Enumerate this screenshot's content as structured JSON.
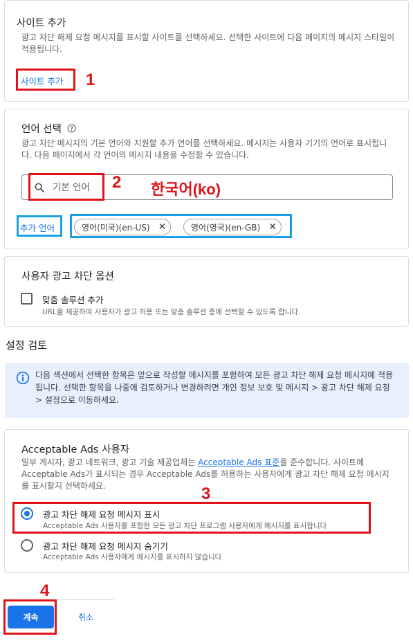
{
  "site_card": {
    "title": "사이트 추가",
    "desc": "광고 차단 해제 요청 메시지를 표시할 사이트를 선택하세요. 선택한 사이트에 다음 페이지의 메시지 스타일이 적용됩니다.",
    "add_site_link": "사이트 추가"
  },
  "language_card": {
    "title": "언어 선택",
    "help_icon": "help-circle-icon",
    "desc": "광고 차단 메시지의 기본 언어와 지원할 추가 언어를 선택하세요. 메시지는 사용자 기기의 언어로 표시됩니다. 다음 페이지에서 각 언어의 메시지 내용을 수정할 수 있습니다.",
    "search_placeholder": "기본 언어",
    "add_language_link": "추가 언어",
    "chips": [
      {
        "label": "영어(미국)(en-US)"
      },
      {
        "label": "영어(영국)(en-GB)"
      }
    ]
  },
  "user_options_card": {
    "title": "사용자 광고 차단 옵션",
    "checkbox_label": "맞춤 솔루션 추가",
    "checkbox_desc": "URL을 제공하여 사용자가 광고 허용 또는 맞춤 솔루션 중에 선택할 수 있도록 합니다."
  },
  "review": {
    "heading": "설정 검토",
    "info_text": "다음 섹션에서 선택한 항목은 앞으로 작성할 메시지를 포함하여 모든 광고 차단 해제 요청 메시지에 적용됩니다. 선택한 항목을 나중에 검토하거나 변경하려면 개인 정보 보호 및 메시지 > 광고 차단 해제 요청 > 설정으로 이동하세요."
  },
  "acceptable_ads_card": {
    "title": "Acceptable Ads 사용자",
    "desc_prefix": "일부 게시자, 광고 네트워크, 광고 기술 제공업체는 ",
    "desc_link": "Acceptable Ads 표준",
    "desc_suffix": "을 준수합니다. 사이트에 Acceptable Ads가 표시되는 경우 Acceptable Ads를 허용하는 사용자에게 광고 차단 해제 요청 메시지를 표시할지 선택하세요.",
    "options": [
      {
        "title": "광고 차단 해제 요청 메시지 표시",
        "desc": "Acceptable Ads 사용자를 포함한 모든 광고 차단 프로그램 사용자에게 메시지를 표시합니다",
        "selected": true
      },
      {
        "title": "광고 차단 해제 요청 메시지 숨기기",
        "desc": "Acceptable Ads 사용자에게 메시지를 표시하지 않습니다",
        "selected": false
      }
    ]
  },
  "footer": {
    "continue_label": "계속",
    "cancel_label": "취소"
  },
  "annotations": {
    "n1": "1",
    "n2": "2",
    "n3": "3",
    "n4": "4",
    "language_note": "한국어(ko)"
  },
  "colors": {
    "accent": "#1a73e8",
    "annotation_red": "#e0131b",
    "annotation_blue": "#1ba1e2",
    "info_bg": "#e8f0fe"
  }
}
